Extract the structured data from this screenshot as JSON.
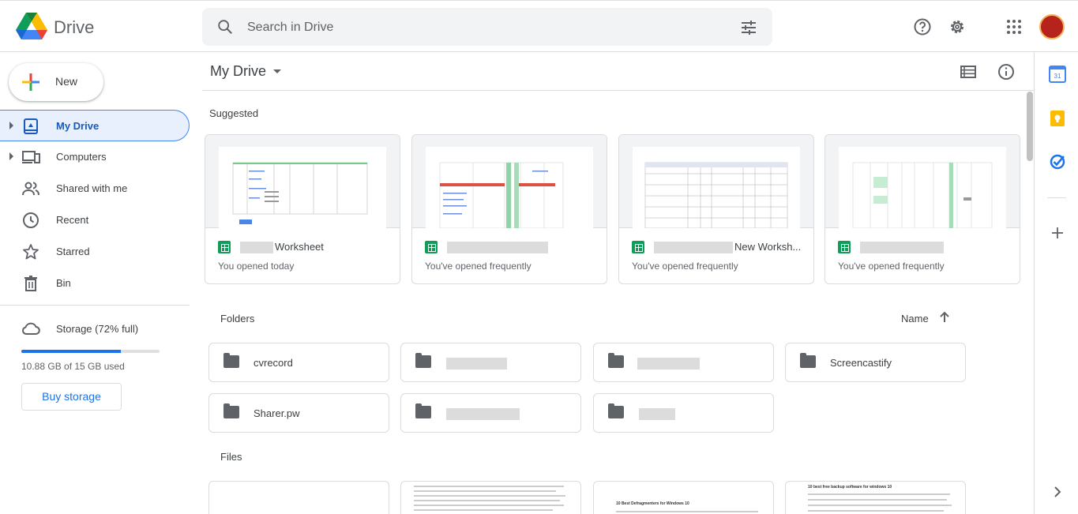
{
  "header": {
    "brand": "Drive",
    "search_placeholder": "Search in Drive",
    "icons": [
      "search-icon",
      "tune-icon",
      "help-icon",
      "settings-icon",
      "apps-icon",
      "avatar"
    ]
  },
  "sidebar": {
    "new_label": "New",
    "items": [
      {
        "label": "My Drive",
        "icon": "my-drive-icon"
      },
      {
        "label": "Computers",
        "icon": "computers-icon"
      },
      {
        "label": "Shared with me",
        "icon": "shared-icon"
      },
      {
        "label": "Recent",
        "icon": "clock-icon"
      },
      {
        "label": "Starred",
        "icon": "star-icon"
      },
      {
        "label": "Bin",
        "icon": "bin-icon"
      }
    ],
    "storage": {
      "label": "Storage (72% full)",
      "fraction_used": 0.72,
      "used_text": "10.88 GB of 15 GB used",
      "buy_label": "Buy storage"
    }
  },
  "main": {
    "title": "My Drive",
    "suggested_label": "Suggested",
    "suggested": [
      {
        "name": "Worksheet",
        "sub": "You opened today"
      },
      {
        "name": "",
        "sub": "You've opened frequently"
      },
      {
        "name": "New Worksh...",
        "sub": "You've opened frequently"
      },
      {
        "name": "",
        "sub": "You've opened frequently"
      }
    ],
    "folders_label": "Folders",
    "sort_label": "Name",
    "folders": [
      {
        "name": "cvrecord"
      },
      {
        "name": ""
      },
      {
        "name": ""
      },
      {
        "name": "Screencastify"
      },
      {
        "name": "Sharer.pw"
      },
      {
        "name": ""
      },
      {
        "name": ""
      }
    ],
    "files_label": "Files",
    "files": [
      {
        "title": ""
      },
      {
        "title": ""
      },
      {
        "title": "10 Best Defragmenters for Windows 10"
      },
      {
        "title": "10 best free backup software for windows 10"
      }
    ]
  },
  "colors": {
    "accent": "#1a73e8",
    "sheets_green": "#0f9d58",
    "active_nav_bg": "#e8f0fe"
  }
}
